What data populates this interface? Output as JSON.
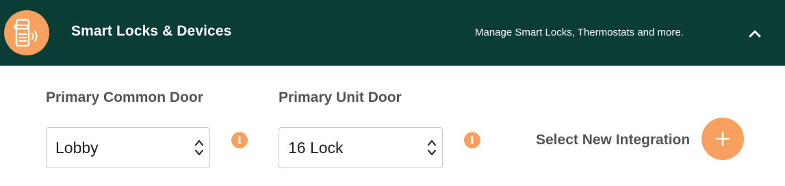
{
  "header": {
    "title": "Smart Locks & Devices",
    "subtitle": "Manage Smart Locks, Thermostats and more.",
    "icon": "smart-lock-icon",
    "collapse_icon": "chevron-up-icon",
    "bg_color": "#0a3d36",
    "accent_color": "#f7a05f"
  },
  "fields": {
    "common_door": {
      "label": "Primary Common Door",
      "value": "Lobby"
    },
    "unit_door": {
      "label": "Primary Unit Door",
      "value": "16 Lock"
    }
  },
  "info_glyph": "i",
  "integration": {
    "label": "Select New Integration",
    "icon": "plus-icon"
  }
}
